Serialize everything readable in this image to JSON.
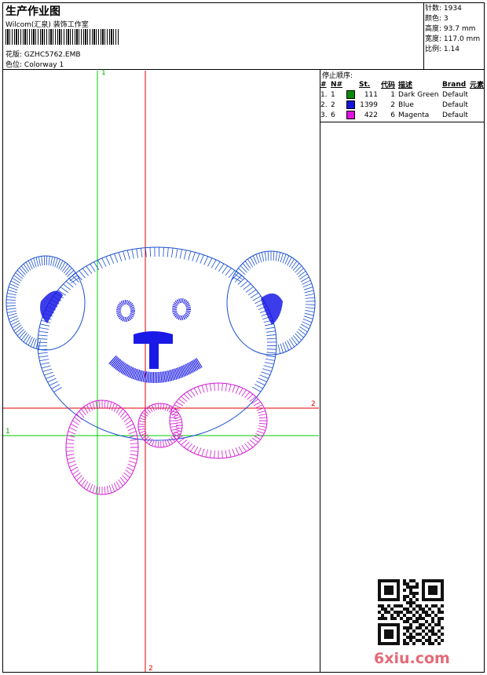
{
  "header": {
    "title": "生产作业图",
    "company": "Wilcom(汇泉) 装饰工作室",
    "design_file_label": "花版:",
    "design_file": "GZHC5762.EMB",
    "colorway_label": "色位:",
    "colorway": "Colorway 1"
  },
  "stats": {
    "stitches_label": "针数:",
    "stitches": "1934",
    "colors_label": "颜色:",
    "colors": "3",
    "height_label": "高度:",
    "height": "93.7 mm",
    "width_label": "宽度:",
    "width": "117.0 mm",
    "scale_label": "比例:",
    "scale": "1.14"
  },
  "stop_sequence": {
    "title": "停止顺序:",
    "headers": [
      "#",
      "N#",
      "St.",
      "代码",
      "描述",
      "Brand",
      "元素"
    ],
    "rows": [
      {
        "index": "1.",
        "needle": "1",
        "color": "#0a8a0a",
        "stitches": "111",
        "code": "1",
        "description": "Dark Green",
        "brand": "Default"
      },
      {
        "index": "2.",
        "needle": "2",
        "color": "#1414dc",
        "stitches": "1399",
        "code": "2",
        "description": "Blue",
        "brand": "Default"
      },
      {
        "index": "3.",
        "needle": "6",
        "color": "#e010e0",
        "stitches": "422",
        "code": "6",
        "description": "Magenta",
        "brand": "Default"
      }
    ]
  },
  "axes": {
    "green_top": "1",
    "green_left": "1",
    "red_right": "2",
    "red_bottom": "2"
  },
  "colors": {
    "green_axis": "#00cc00",
    "red_axis": "#e00000",
    "outline": "#1a4fd0",
    "blue_fill": "#1a1ae6",
    "magenta": "#d21ad2"
  },
  "watermark": "6xiu.com"
}
